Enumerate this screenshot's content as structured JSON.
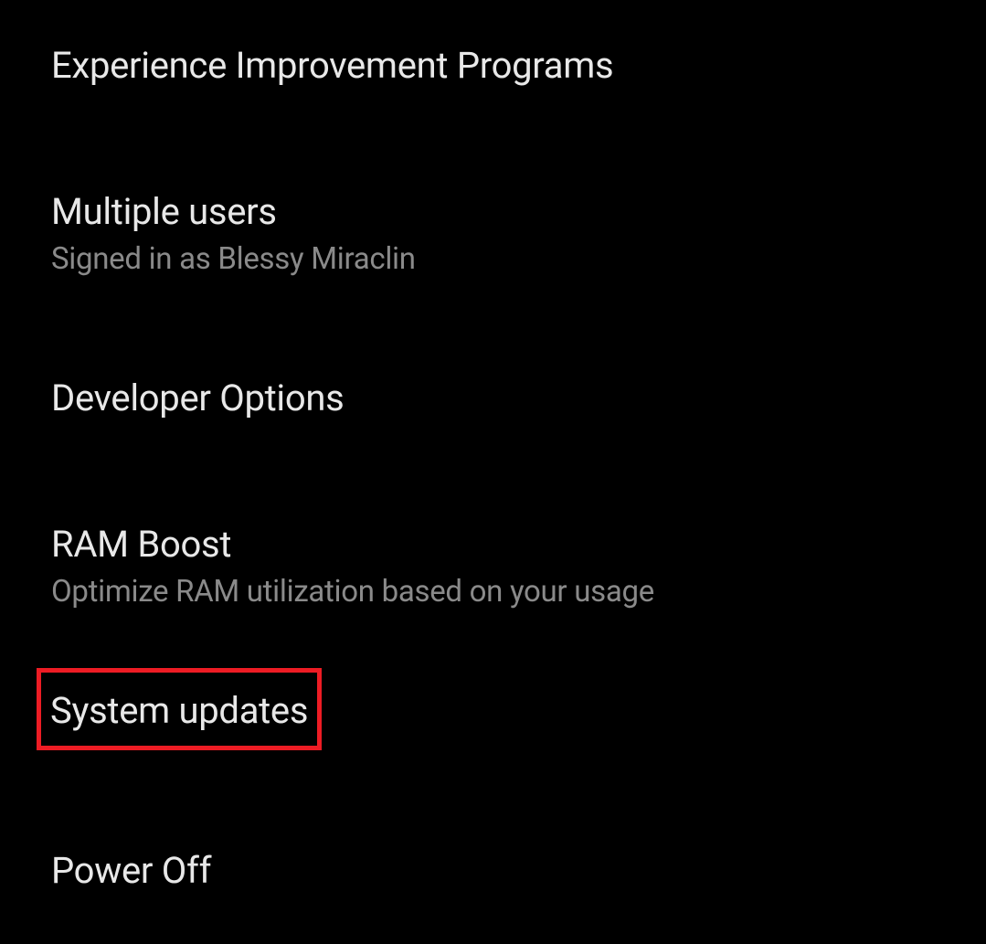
{
  "settings": {
    "items": [
      {
        "title": "Experience Improvement Programs",
        "subtitle": null
      },
      {
        "title": "Multiple users",
        "subtitle": "Signed in as Blessy Miraclin"
      },
      {
        "title": "Developer Options",
        "subtitle": null
      },
      {
        "title": "RAM Boost",
        "subtitle": "Optimize RAM utilization based on your usage"
      },
      {
        "title": "System updates",
        "subtitle": null
      },
      {
        "title": "Power Off",
        "subtitle": null
      }
    ]
  }
}
